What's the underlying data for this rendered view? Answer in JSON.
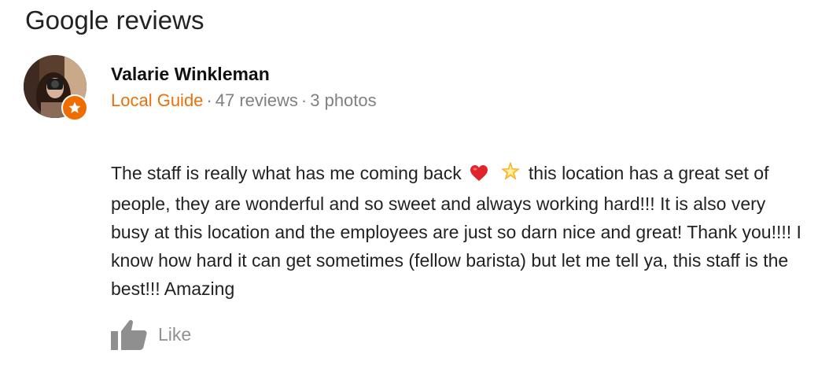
{
  "section": {
    "title": "Google reviews"
  },
  "review": {
    "author": "Valarie Winkleman",
    "badge": "Local Guide",
    "reviews_count": "47 reviews",
    "photos_count": "3 photos",
    "separator": "·",
    "text_part1": "The staff is really what has me coming back",
    "text_part2": "this location has a great set of people, they are wonderful and so sweet and always working hard!!! It is also very busy at this location and the employees are just so darn nice and great! Thank you!!!! I know how hard it can get sometimes (fellow barista) but let me tell ya, this staff is the best!!! Amazing",
    "emojis": [
      "red-heart-icon",
      "glowing-star-icon"
    ],
    "like_label": "Like"
  },
  "colors": {
    "local_guide": "#e8710a",
    "meta_gray": "#808080",
    "like_gray": "#909090"
  }
}
